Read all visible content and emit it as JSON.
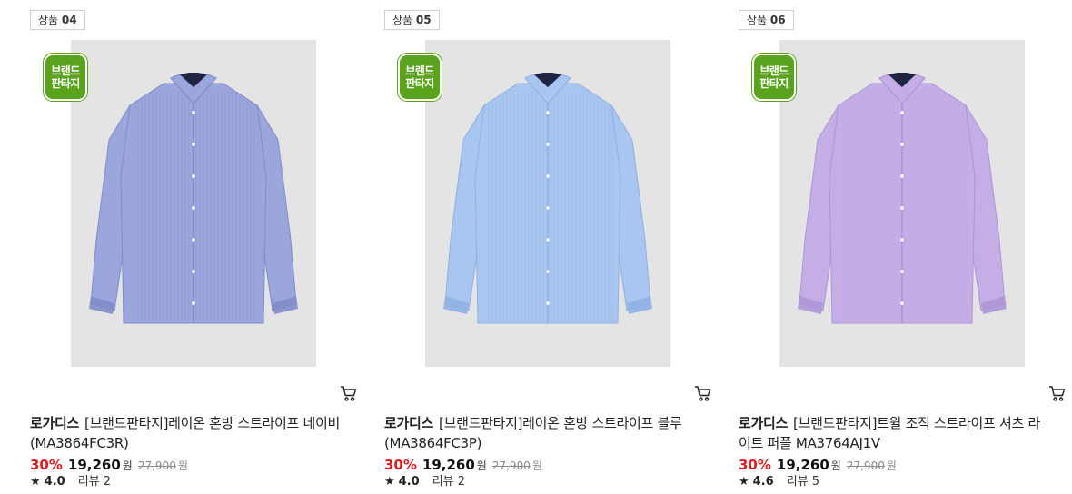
{
  "products": [
    {
      "badge_label": "상품",
      "badge_num": "04",
      "stamp_line1": "브랜드",
      "stamp_line2": "판타지",
      "brand": "로가디스",
      "name_line1": "[브랜드판타지]레이온 혼방 스트라이프 네이비",
      "name_line2": "(MA3864FC3R)",
      "discount": "30%",
      "price": "19,260",
      "price_unit": "원",
      "original_price": "27,900",
      "original_unit": "원",
      "rating": "4.0",
      "review_label": "리뷰 2",
      "shirt_color": "#9aa6dc",
      "shirt_shade": "#7f8cc8"
    },
    {
      "badge_label": "상품",
      "badge_num": "05",
      "stamp_line1": "브랜드",
      "stamp_line2": "판타지",
      "brand": "로가디스",
      "name_line1": "[브랜드판타지]레이온 혼방 스트라이프 블루",
      "name_line2": "(MA3864FC3P)",
      "discount": "30%",
      "price": "19,260",
      "price_unit": "원",
      "original_price": "27,900",
      "original_unit": "원",
      "rating": "4.0",
      "review_label": "리뷰 2",
      "shirt_color": "#a9c6f0",
      "shirt_shade": "#8fb0e2"
    },
    {
      "badge_label": "상품",
      "badge_num": "06",
      "stamp_line1": "브랜드",
      "stamp_line2": "판타지",
      "brand": "로가디스",
      "name_line1": "[브랜드판타지]트윌 조직 스트라이프 셔츠 라",
      "name_line2": "이트 퍼플 MA3764AJ1V",
      "discount": "30%",
      "price": "19,260",
      "price_unit": "원",
      "original_price": "27,900",
      "original_unit": "원",
      "rating": "4.6",
      "review_label": "리뷰 5",
      "shirt_color": "#c5aee6",
      "shirt_shade": "#ad95d6"
    }
  ]
}
